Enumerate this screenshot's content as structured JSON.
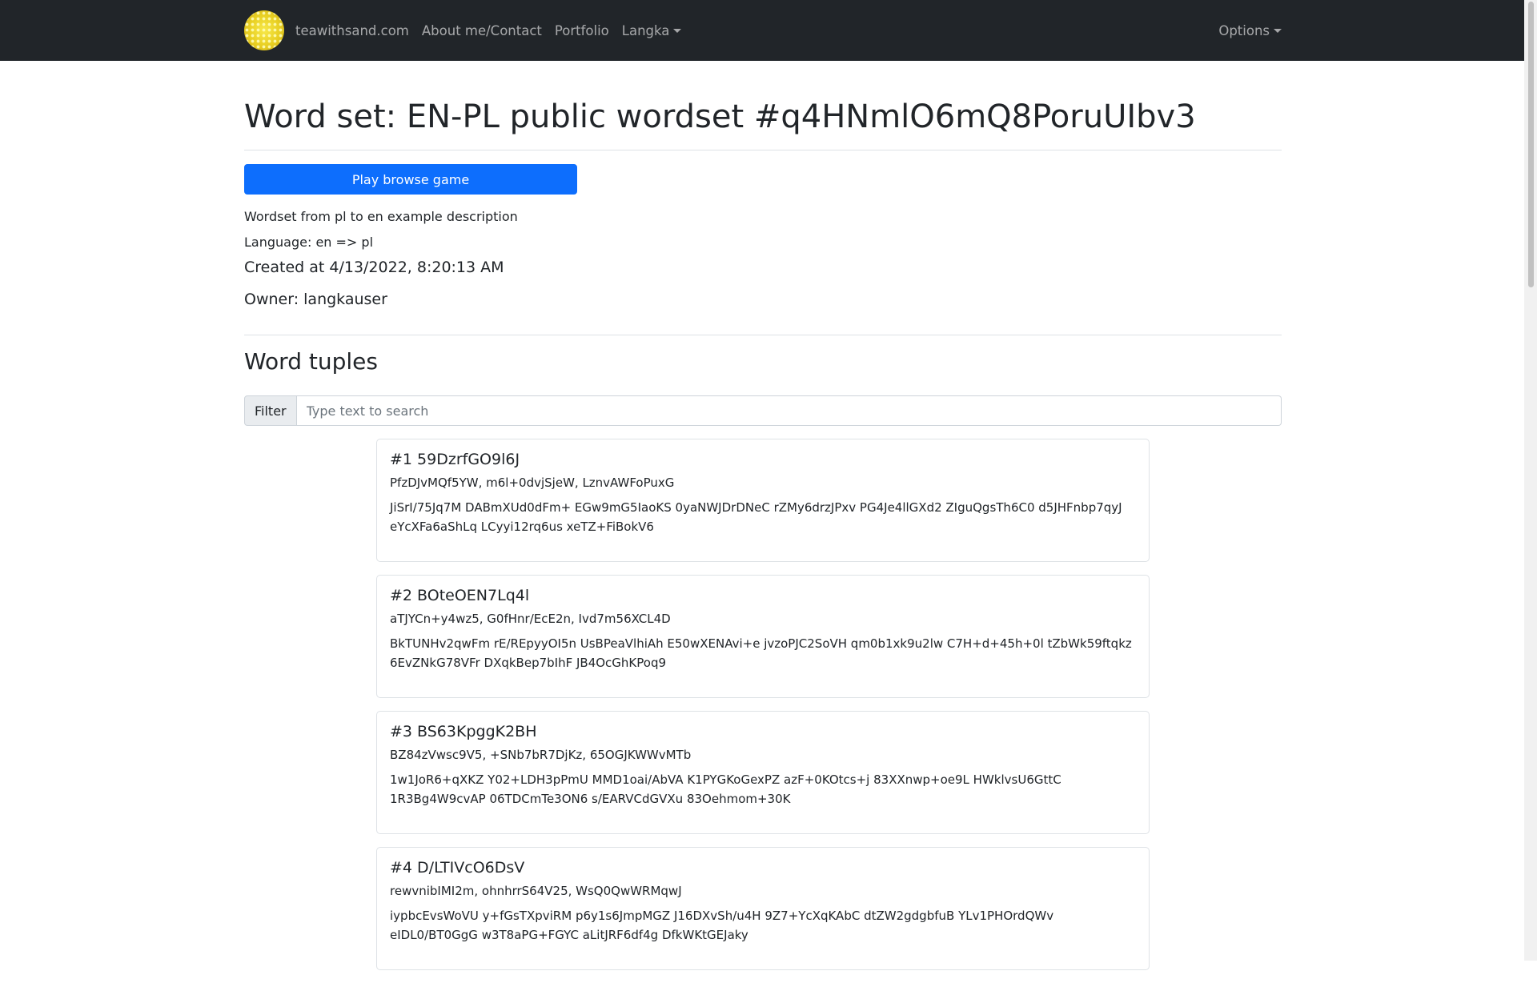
{
  "navbar": {
    "brand": "teawithsand.com",
    "links": [
      "About me/Contact",
      "Portfolio",
      "Langka"
    ],
    "options_label": "Options"
  },
  "page": {
    "title": "Word set: EN-PL public wordset #q4HNmlO6mQ8PoruUIbv3",
    "play_button": "Play browse game",
    "description": "Wordset from pl to en example description",
    "language": "Language: en => pl",
    "created": "Created at 4/13/2022, 8:20:13 AM",
    "owner": "Owner: langkauser",
    "section_title": "Word tuples"
  },
  "filter": {
    "label": "Filter",
    "placeholder": "Type text to search",
    "value": ""
  },
  "tuples": [
    {
      "title": "#1 59DzrfGO9l6J",
      "words": "PfzDJvMQf5YW, m6l+0dvjSjeW, LznvAWFoPuxG",
      "description": "JiSrI/75Jq7M DABmXUd0dFm+ EGw9mG5IaoKS 0yaNWJDrDNeC rZMy6drzJPxv PG4Je4llGXd2 ZIguQgsTh6C0 d5JHFnbp7qyJ eYcXFa6aShLq LCyyi12rq6us xeTZ+FiBokV6"
    },
    {
      "title": "#2 BOteOEN7Lq4l",
      "words": "aTJYCn+y4wz5, G0fHnr/EcE2n, Ivd7m56XCL4D",
      "description": "BkTUNHv2qwFm rE/REpyyOI5n UsBPeaVlhiAh E50wXENAvi+e jvzoPJC2SoVH qm0b1xk9u2lw C7H+d+45h+0l tZbWk59ftqkz 6EvZNkG78VFr DXqkBep7bIhF JB4OcGhKPoq9"
    },
    {
      "title": "#3 BS63KpggK2BH",
      "words": "BZ84zVwsc9V5, +SNb7bR7DjKz, 65OGJKWWvMTb",
      "description": "1w1JoR6+qXKZ Y02+LDH3pPmU MMD1oai/AbVA K1PYGKoGexPZ azF+0KOtcs+j 83XXnwp+oe9L HWklvsU6GttC 1R3Bg4W9cvAP 06TDCmTe3ON6 s/EARVCdGVXu 83Oehmom+30K"
    },
    {
      "title": "#4 D/LTIVcO6DsV",
      "words": "rewvnibIMI2m, ohnhrrS64V25, WsQ0QwWRMqwJ",
      "description": "iypbcEvsWoVU y+fGsTXpviRM p6y1s6JmpMGZ J16DXvSh/u4H 9Z7+YcXqKAbC dtZW2gdgbfuB YLv1PHOrdQWv eIDL0/BT0GgG w3T8aPG+FGYC aLitJRF6df4g DfkWKtGEJaky"
    }
  ]
}
